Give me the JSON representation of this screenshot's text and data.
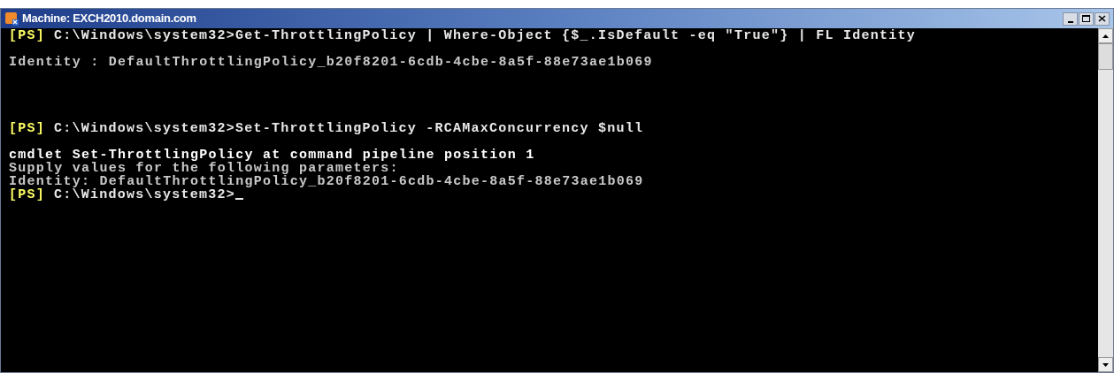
{
  "window": {
    "title": "Machine: EXCH2010.domain.com"
  },
  "console": {
    "lines": [
      {
        "kind": "prompt",
        "prompt": "[PS]",
        "text": "C:\\Windows\\system32>Get-ThrottlingPolicy | Where-Object {$_.IsDefault -eq \"True\"} | FL Identity"
      },
      {
        "kind": "blank"
      },
      {
        "kind": "output",
        "text": "Identity : DefaultThrottlingPolicy_b20f8201-6cdb-4cbe-8a5f-88e73ae1b069"
      },
      {
        "kind": "blank"
      },
      {
        "kind": "blank"
      },
      {
        "kind": "blank"
      },
      {
        "kind": "blank"
      },
      {
        "kind": "prompt",
        "prompt": "[PS]",
        "text": "C:\\Windows\\system32>Set-ThrottlingPolicy -RCAMaxConcurrency $null"
      },
      {
        "kind": "blank"
      },
      {
        "kind": "bright",
        "text": "cmdlet Set-ThrottlingPolicy at command pipeline position 1"
      },
      {
        "kind": "output",
        "text": "Supply values for the following parameters:"
      },
      {
        "kind": "output",
        "text": "Identity: DefaultThrottlingPolicy_b20f8201-6cdb-4cbe-8a5f-88e73ae1b069"
      },
      {
        "kind": "prompt",
        "prompt": "[PS]",
        "text": "C:\\Windows\\system32>",
        "cursor": true
      }
    ]
  }
}
